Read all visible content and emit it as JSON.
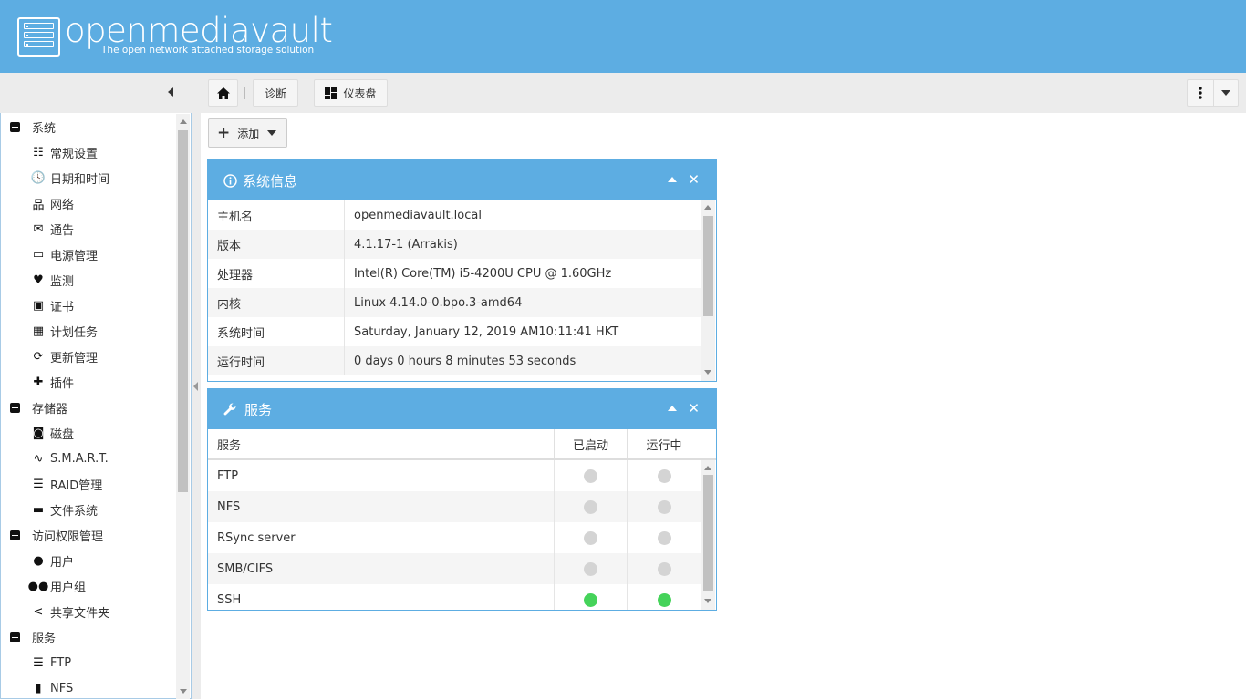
{
  "brand": {
    "name": "openmediavault",
    "tagline": "The open network attached storage solution"
  },
  "toolbar": {
    "breadcrumb": [
      "诊断",
      "仪表盘"
    ]
  },
  "sidebar": [
    {
      "type": "group",
      "label": "系统"
    },
    {
      "type": "item",
      "icon": "sliders-icon",
      "glyph": "☷",
      "label": "常规设置"
    },
    {
      "type": "item",
      "icon": "clock-icon",
      "glyph": "🕓",
      "label": "日期和时间"
    },
    {
      "type": "item",
      "icon": "network-icon",
      "glyph": "品",
      "label": "网络"
    },
    {
      "type": "item",
      "icon": "envelope-icon",
      "glyph": "✉",
      "label": "通告"
    },
    {
      "type": "item",
      "icon": "battery-icon",
      "glyph": "▭",
      "label": "电源管理"
    },
    {
      "type": "item",
      "icon": "heartbeat-icon",
      "glyph": "♥",
      "label": "监测"
    },
    {
      "type": "item",
      "icon": "certificate-icon",
      "glyph": "▣",
      "label": "证书"
    },
    {
      "type": "item",
      "icon": "calendar-icon",
      "glyph": "▦",
      "label": "计划任务"
    },
    {
      "type": "item",
      "icon": "refresh-icon",
      "glyph": "⟳",
      "label": "更新管理"
    },
    {
      "type": "item",
      "icon": "puzzle-icon",
      "glyph": "✚",
      "label": "插件"
    },
    {
      "type": "group",
      "label": "存储器"
    },
    {
      "type": "item",
      "icon": "disk-icon",
      "glyph": "◙",
      "label": "磁盘"
    },
    {
      "type": "item",
      "icon": "pulse-icon",
      "glyph": "∿",
      "label": "S.M.A.R.T."
    },
    {
      "type": "item",
      "icon": "database-icon",
      "glyph": "☰",
      "label": "RAID管理"
    },
    {
      "type": "item",
      "icon": "folder-icon",
      "glyph": "▬",
      "label": "文件系统"
    },
    {
      "type": "group",
      "label": "访问权限管理"
    },
    {
      "type": "item",
      "icon": "user-icon",
      "glyph": "●",
      "label": "用户"
    },
    {
      "type": "item",
      "icon": "users-icon",
      "glyph": "●●",
      "label": "用户组"
    },
    {
      "type": "item",
      "icon": "share-icon",
      "glyph": "<",
      "label": "共享文件夹"
    },
    {
      "type": "group",
      "label": "服务"
    },
    {
      "type": "item",
      "icon": "server-icon",
      "glyph": "☰",
      "label": "FTP"
    },
    {
      "type": "item",
      "icon": "nfs-icon",
      "glyph": "▮",
      "label": "NFS"
    }
  ],
  "add_button": {
    "label": "添加"
  },
  "sysinfo": {
    "title": "系统信息",
    "rows": [
      {
        "key": "主机名",
        "value": "openmediavault.local"
      },
      {
        "key": "版本",
        "value": "4.1.17-1 (Arrakis)"
      },
      {
        "key": "处理器",
        "value": "Intel(R) Core(TM) i5-4200U CPU @ 1.60GHz"
      },
      {
        "key": "内核",
        "value": "Linux 4.14.0-0.bpo.3-amd64"
      },
      {
        "key": "系统时间",
        "value": "Saturday, January 12, 2019 AM10:11:41 HKT"
      },
      {
        "key": "运行时间",
        "value": "0 days 0 hours 8 minutes 53 seconds"
      }
    ]
  },
  "services": {
    "title": "服务",
    "columns": [
      "服务",
      "已启动",
      "运行中"
    ],
    "rows": [
      {
        "name": "FTP",
        "enabled": false,
        "running": false
      },
      {
        "name": "NFS",
        "enabled": false,
        "running": false
      },
      {
        "name": "RSync server",
        "enabled": false,
        "running": false
      },
      {
        "name": "SMB/CIFS",
        "enabled": false,
        "running": false
      },
      {
        "name": "SSH",
        "enabled": true,
        "running": true
      }
    ]
  },
  "colors": {
    "header": "#5dade2",
    "active_dot": "#45d35a",
    "inactive_dot": "#d4d4d4"
  }
}
